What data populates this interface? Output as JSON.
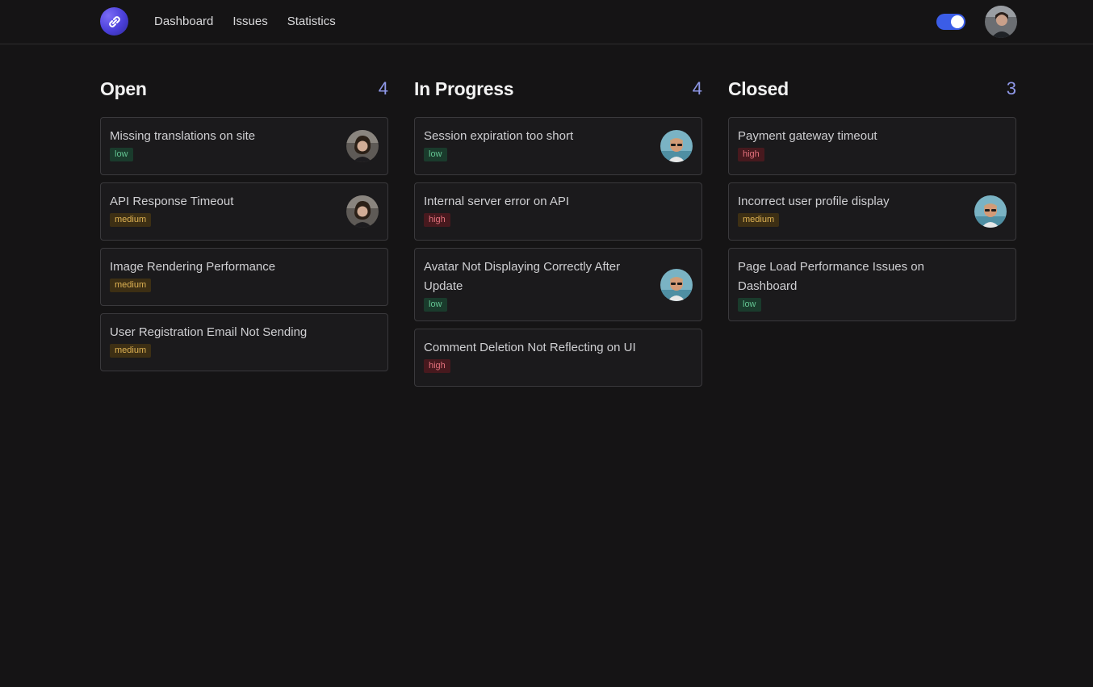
{
  "nav": {
    "links": [
      "Dashboard",
      "Issues",
      "Statistics"
    ],
    "theme_toggle_on": true
  },
  "columns": [
    {
      "title": "Open",
      "count": "4",
      "cards": [
        {
          "title": "Missing translations on site",
          "priority": "low",
          "avatar": "woman"
        },
        {
          "title": "API Response Timeout",
          "priority": "medium",
          "avatar": "woman"
        },
        {
          "title": "Image Rendering Performance",
          "priority": "medium",
          "avatar": ""
        },
        {
          "title": "User Registration Email Not Sending",
          "priority": "medium",
          "avatar": ""
        }
      ]
    },
    {
      "title": "In Progress",
      "count": "4",
      "cards": [
        {
          "title": "Session expiration too short",
          "priority": "low",
          "avatar": "man"
        },
        {
          "title": "Internal server error on API",
          "priority": "high",
          "avatar": ""
        },
        {
          "title": "Avatar Not Displaying Correctly After Update",
          "priority": "low",
          "avatar": "man"
        },
        {
          "title": "Comment Deletion Not Reflecting on UI",
          "priority": "high",
          "avatar": ""
        }
      ]
    },
    {
      "title": "Closed",
      "count": "3",
      "cards": [
        {
          "title": "Payment gateway timeout",
          "priority": "high",
          "avatar": ""
        },
        {
          "title": "Incorrect user profile display",
          "priority": "medium",
          "avatar": "man"
        },
        {
          "title": "Page Load Performance Issues on Dashboard",
          "priority": "low",
          "avatar": ""
        }
      ]
    }
  ],
  "colors": {
    "background": "#151415",
    "card_background": "#1b1a1c",
    "accent": "#3b5de7",
    "count": "#8f98e8",
    "priority_low": "#63c391",
    "priority_medium": "#e0b454",
    "priority_high": "#e1707b"
  }
}
